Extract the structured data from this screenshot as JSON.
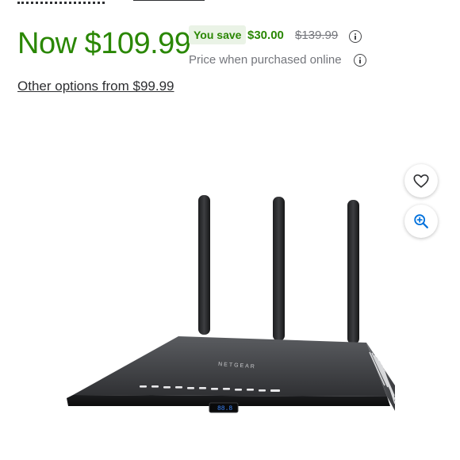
{
  "price": {
    "now": "Now $109.99",
    "you_save_label": "You save",
    "save_amount": "$30.00",
    "was_price": "$139.99",
    "note": "Price when purchased online"
  },
  "other_options": "Other options from $99.99",
  "product_image": {
    "brand": "NETGEAR",
    "led_display": "88.8"
  },
  "actions": {
    "favorite_icon": "heart-icon",
    "zoom_icon": "zoom-in-icon"
  },
  "colors": {
    "accent_green": "#2a8703",
    "badge_bg": "#eaf3e6",
    "muted_text": "#74767c"
  }
}
